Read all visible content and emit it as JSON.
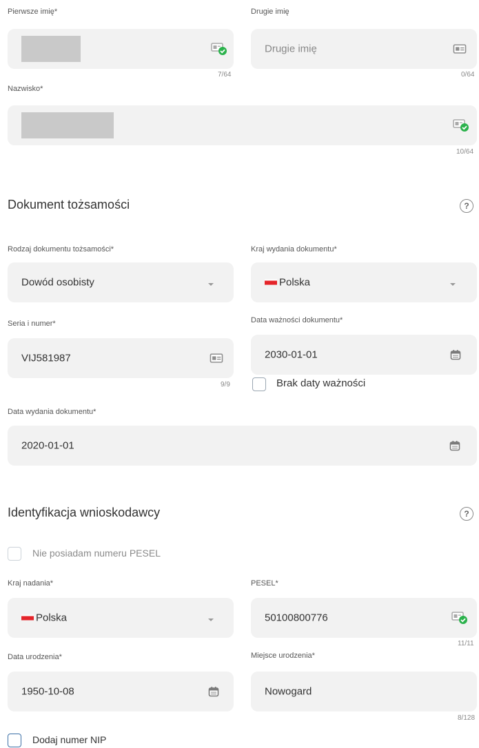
{
  "personal": {
    "first_name": {
      "label": "Pierwsze imię*",
      "counter": "7/64"
    },
    "second_name": {
      "label": "Drugie imię",
      "placeholder": "Drugie imię",
      "counter": "0/64"
    },
    "surname": {
      "label": "Nazwisko*",
      "counter": "10/64"
    }
  },
  "document": {
    "title": "Dokument tożsamości",
    "help": "?",
    "type": {
      "label": "Rodzaj dokumentu tożsamości*",
      "value": "Dowód osobisty"
    },
    "country": {
      "label": "Kraj wydania dokumentu*",
      "value": "Polska"
    },
    "number": {
      "label": "Seria i numer*",
      "value": "VIJ581987",
      "counter": "9/9"
    },
    "expiry": {
      "label": "Data ważności dokumentu*",
      "value": "2030-01-01"
    },
    "no_expiry": {
      "label": "Brak daty ważności",
      "checked": false
    },
    "issue_date": {
      "label": "Data wydania dokumentu*",
      "value": "2020-01-01"
    }
  },
  "identification": {
    "title": "Identyfikacja wnioskodawcy",
    "help": "?",
    "no_pesel": {
      "label": "Nie posiadam numeru PESEL",
      "checked": false
    },
    "country": {
      "label": "Kraj nadania*",
      "value": "Polska"
    },
    "pesel": {
      "label": "PESEL*",
      "value": "50100800776",
      "counter": "11/11"
    },
    "birth_date": {
      "label": "Data urodzenia*",
      "value": "1950-10-08"
    },
    "birth_place": {
      "label": "Miejsce urodzenia*",
      "value": "Nowogard",
      "counter": "8/128"
    },
    "add_nip": {
      "label": "Dodaj numer NIP",
      "checked": false
    }
  },
  "colors": {
    "field_bg": "#f2f2f2",
    "valid_green": "#2bb24c",
    "flag_red": "#e4242a",
    "checkbox_blue": "#3a6ea5"
  },
  "icons": {
    "id_card": "id-card-icon",
    "id_card_valid": "id-card-check-icon",
    "calendar": "calendar-icon",
    "help": "help-icon",
    "dropdown": "chevron-down-icon",
    "flag": "poland-flag-icon"
  }
}
